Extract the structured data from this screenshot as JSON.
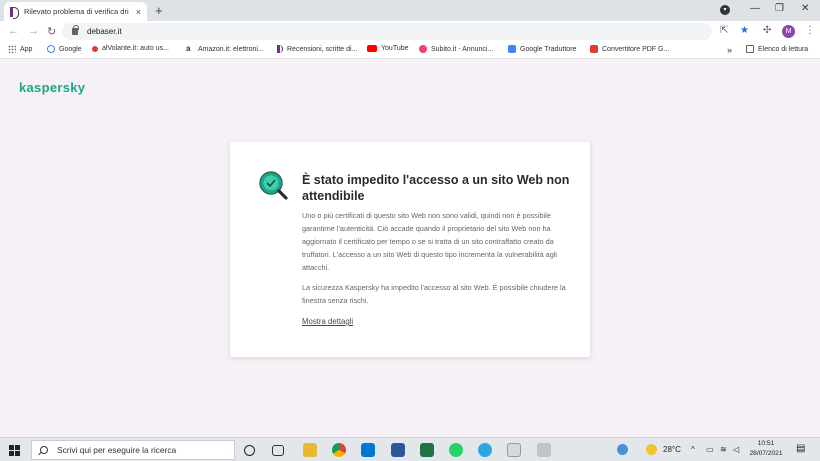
{
  "browser": {
    "tab_title": "Rilevato problema di verifica dri",
    "tab_close": "×",
    "new_tab": "+",
    "address": "debaser.it",
    "profile_initial": "M"
  },
  "bookmarks": [
    {
      "label": "App",
      "color": "#5f6368"
    },
    {
      "label": "Google",
      "color": "#4285f4"
    },
    {
      "label": "alVolante.it: auto us...",
      "color": "#e53935"
    },
    {
      "label": "Amazon.it: elettroni...",
      "color": "#222222"
    },
    {
      "label": "Recensioni, scritte di...",
      "color": "#7a2b8f"
    },
    {
      "label": "YouTube",
      "color": "#ff0000"
    },
    {
      "label": "Subito.it - Annunci...",
      "color": "#f4436b"
    },
    {
      "label": "Google Traduttore",
      "color": "#4285f4"
    },
    {
      "label": "Convertitore PDF G...",
      "color": "#e53935"
    }
  ],
  "reading_list": "Elenco di lettura",
  "page": {
    "brand": "kaspersky",
    "heading": "È stato impedito l'accesso a un sito Web non attendibile",
    "paragraph1": "Uno o più certificati di questo sito Web non sono validi, quindi non è possibile garantirne l'autenticità. Ciò accade quando il proprietario del sito Web non ha aggiornato il certificato per tempo o se si tratta di un sito contraffatto creato da truffatori. L'accesso a un sito Web di questo tipo incrementa la vulnerabilità agli attacchi.",
    "paragraph2": "La sicurezza Kaspersky ha impedito l'accesso al sito Web. È possibile chiudere la finestra senza rischi.",
    "more_link": "Mostra dettagli"
  },
  "taskbar": {
    "search_placeholder": "Scrivi qui per eseguire la ricerca",
    "temperature": "28°C",
    "time": "10:51",
    "date": "28/07/2021"
  },
  "colors": {
    "accent": "#1aa78a",
    "page_bg": "#f6f1f6"
  }
}
